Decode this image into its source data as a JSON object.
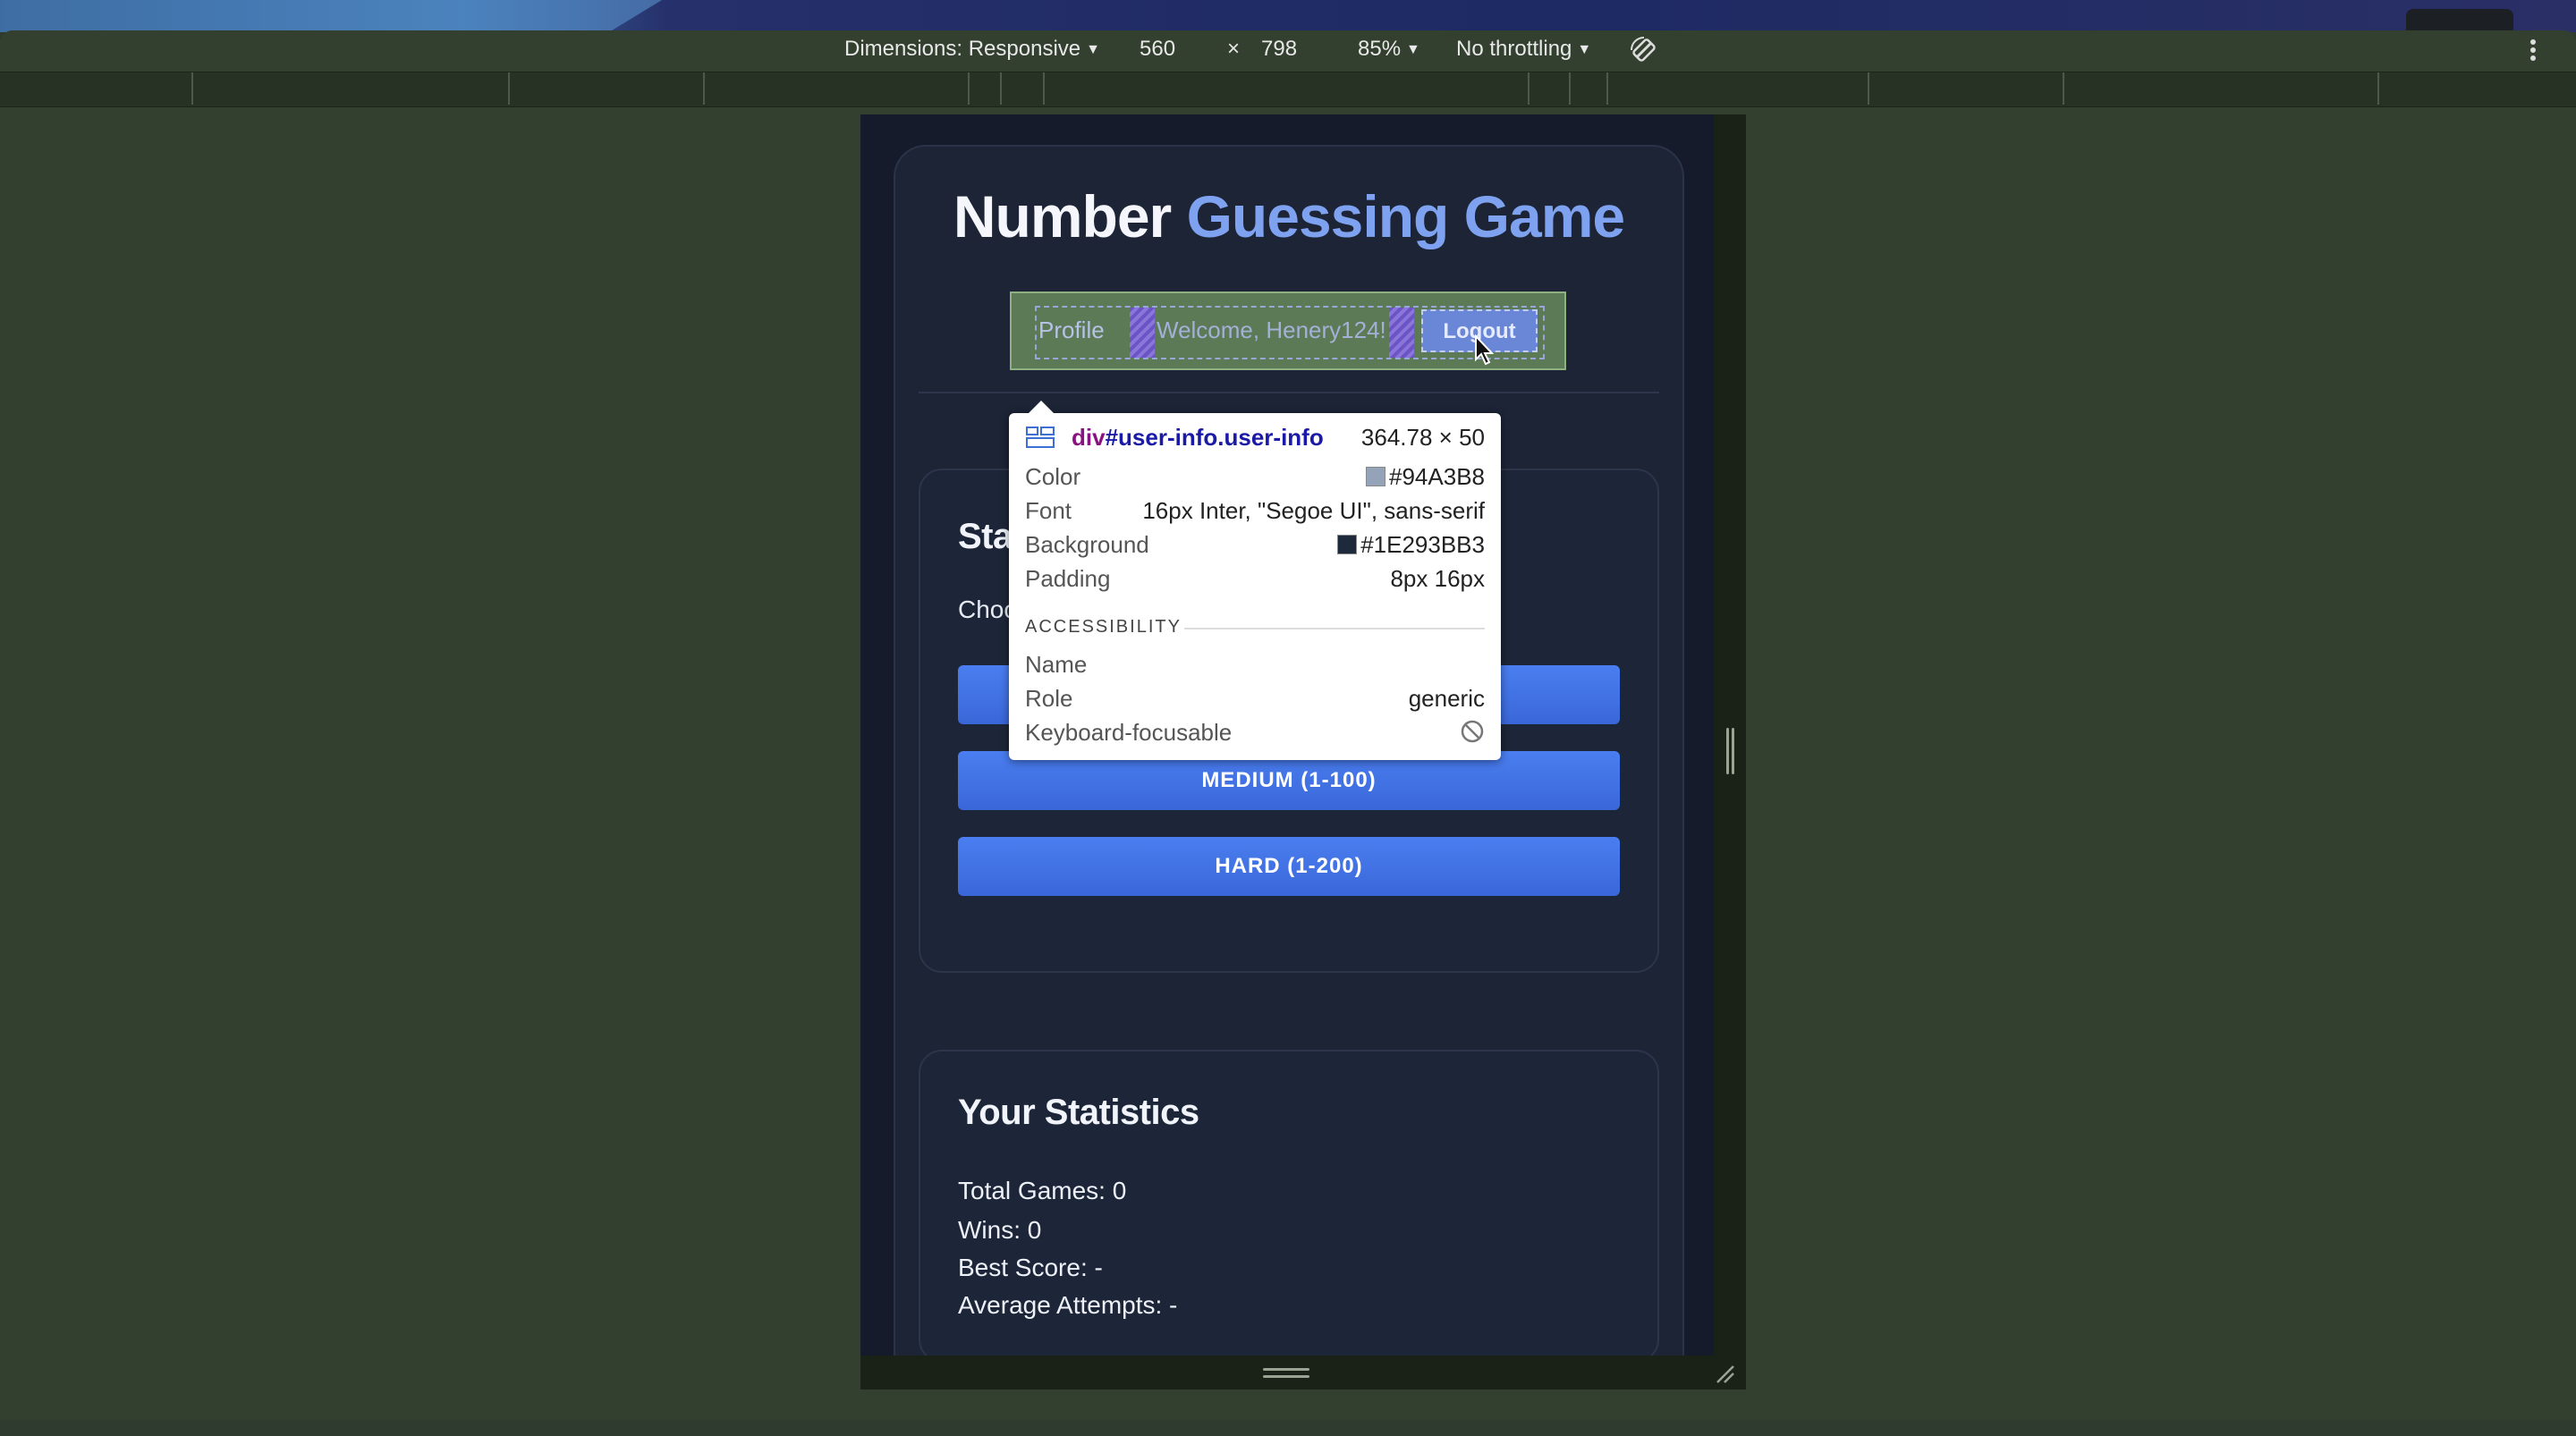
{
  "devtools": {
    "dimensions_label": "Dimensions: Responsive",
    "width_value": "560",
    "times": "×",
    "height_value": "798",
    "zoom": "85%",
    "throttling": "No throttling",
    "more_menu_icon": "more-vertical-icon",
    "rotate_icon": "rotate-icon"
  },
  "game": {
    "title_part1": "Number",
    "title_part2": "Guessing Game",
    "user_info": {
      "profile_alt": "Profile",
      "welcome": "Welcome, Henery124!",
      "logout": "Logout"
    },
    "start": {
      "title": "Sta",
      "choose_text": "Choo",
      "buttons": [
        "MEDIUM (1-100)",
        "HARD (1-200)"
      ]
    },
    "stats": {
      "title": "Your Statistics",
      "lines": [
        "Total Games: 0",
        "Wins: 0",
        "Best Score: -",
        "Average Attempts: -"
      ]
    }
  },
  "inspector": {
    "selector_tag": "div",
    "selector_rest": "#user-info.user-info",
    "size": "364.78 × 50",
    "rows": [
      {
        "key": "Color",
        "value": "#94A3B8",
        "swatch": "#94a3b8"
      },
      {
        "key": "Font",
        "value": "16px Inter, \"Segoe UI\", sans-serif"
      },
      {
        "key": "Background",
        "value": "#1E293BB3",
        "swatch": "#1e293b"
      },
      {
        "key": "Padding",
        "value": "8px 16px"
      }
    ],
    "accessibility_label": "ACCESSIBILITY",
    "a11y": [
      {
        "key": "Name",
        "value": ""
      },
      {
        "key": "Role",
        "value": "generic"
      },
      {
        "key": "Keyboard-focusable",
        "value": ""
      }
    ]
  },
  "colors": {
    "accent_blue": "#7ea2f0",
    "button_blue": "#3a67d8",
    "user_info_text": "#94a3b8"
  }
}
